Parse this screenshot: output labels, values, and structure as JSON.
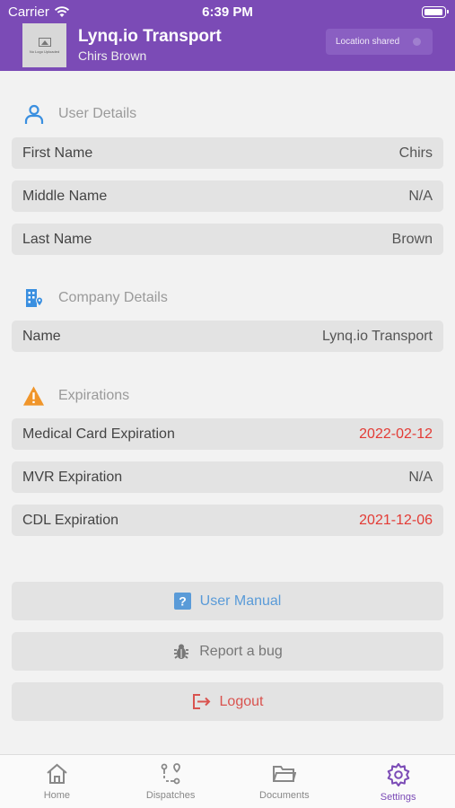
{
  "status_bar": {
    "carrier": "Carrier",
    "time": "6:39 PM"
  },
  "header": {
    "app_title": "Lynq.io Transport",
    "user_name": "Chirs Brown",
    "logo_text": "No Logo Uploaded",
    "location_button": "Location shared"
  },
  "sections": {
    "user": {
      "title": "User Details",
      "rows": [
        {
          "label": "First Name",
          "value": "Chirs"
        },
        {
          "label": "Middle Name",
          "value": "N/A"
        },
        {
          "label": "Last Name",
          "value": "Brown"
        }
      ]
    },
    "company": {
      "title": "Company Details",
      "rows": [
        {
          "label": "Name",
          "value": "Lynq.io Transport"
        }
      ]
    },
    "expirations": {
      "title": "Expirations",
      "rows": [
        {
          "label": "Medical Card Expiration",
          "value": "2022-02-12"
        },
        {
          "label": "MVR Expiration",
          "value": "N/A"
        },
        {
          "label": "CDL Expiration",
          "value": "2021-12-06"
        }
      ]
    }
  },
  "actions": {
    "user_manual": "User Manual",
    "report_bug": "Report a bug",
    "logout": "Logout"
  },
  "tabs": [
    {
      "label": "Home",
      "icon": "home-icon"
    },
    {
      "label": "Dispatches",
      "icon": "route-icon"
    },
    {
      "label": "Documents",
      "icon": "folder-icon"
    },
    {
      "label": "Settings",
      "icon": "gear-icon",
      "active": true
    }
  ],
  "colors": {
    "brand": "#7b4bb6",
    "accent_blue": "#3a8fe0",
    "warning": "#f0952a",
    "expired": "#e33b35",
    "logout": "#d9534f"
  }
}
